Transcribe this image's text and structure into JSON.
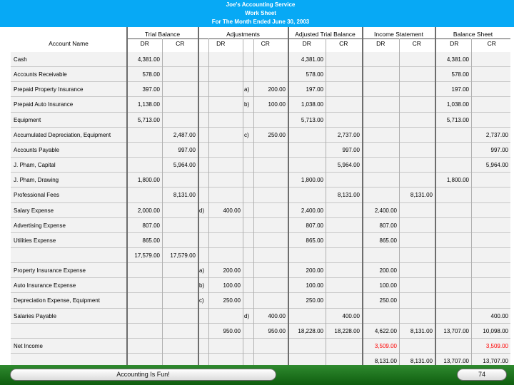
{
  "title": {
    "line1": "Joe's Accounting Service",
    "line2": "Work Sheet",
    "line3": "For The Month Ended June 30, 2003"
  },
  "columns": {
    "account_name": "Account Name",
    "groups": [
      "Trial Balance",
      "Adjustments",
      "Adjusted Trial Balance",
      "Income Statement",
      "Balance Sheet"
    ],
    "dr": "DR",
    "cr": "CR"
  },
  "rows": [
    {
      "name": "Cash",
      "tb_dr": "4,381.00",
      "tb_cr": "",
      "adj_dr_l": "",
      "adj_dr": "",
      "adj_cr_l": "",
      "adj_cr": "",
      "atb_dr": "4,381.00",
      "atb_cr": "",
      "is_dr": "",
      "is_cr": "",
      "bs_dr": "4,381.00",
      "bs_cr": ""
    },
    {
      "name": "Accounts Receivable",
      "tb_dr": "578.00",
      "tb_cr": "",
      "adj_dr_l": "",
      "adj_dr": "",
      "adj_cr_l": "",
      "adj_cr": "",
      "atb_dr": "578.00",
      "atb_cr": "",
      "is_dr": "",
      "is_cr": "",
      "bs_dr": "578.00",
      "bs_cr": ""
    },
    {
      "name": "Prepaid Property Insurance",
      "tb_dr": "397.00",
      "tb_cr": "",
      "adj_dr_l": "",
      "adj_dr": "",
      "adj_cr_l": "a)",
      "adj_cr": "200.00",
      "atb_dr": "197.00",
      "atb_cr": "",
      "is_dr": "",
      "is_cr": "",
      "bs_dr": "197.00",
      "bs_cr": ""
    },
    {
      "name": "Prepaid Auto Insurance",
      "tb_dr": "1,138.00",
      "tb_cr": "",
      "adj_dr_l": "",
      "adj_dr": "",
      "adj_cr_l": "b)",
      "adj_cr": "100.00",
      "atb_dr": "1,038.00",
      "atb_cr": "",
      "is_dr": "",
      "is_cr": "",
      "bs_dr": "1,038.00",
      "bs_cr": ""
    },
    {
      "name": "Equipment",
      "tb_dr": "5,713.00",
      "tb_cr": "",
      "adj_dr_l": "",
      "adj_dr": "",
      "adj_cr_l": "",
      "adj_cr": "",
      "atb_dr": "5,713.00",
      "atb_cr": "",
      "is_dr": "",
      "is_cr": "",
      "bs_dr": "5,713.00",
      "bs_cr": ""
    },
    {
      "name": "Accumulated Depreciation, Equipment",
      "tb_dr": "",
      "tb_cr": "2,487.00",
      "adj_dr_l": "",
      "adj_dr": "",
      "adj_cr_l": "c)",
      "adj_cr": "250.00",
      "atb_dr": "",
      "atb_cr": "2,737.00",
      "is_dr": "",
      "is_cr": "",
      "bs_dr": "",
      "bs_cr": "2,737.00"
    },
    {
      "name": "Accounts Payable",
      "tb_dr": "",
      "tb_cr": "997.00",
      "adj_dr_l": "",
      "adj_dr": "",
      "adj_cr_l": "",
      "adj_cr": "",
      "atb_dr": "",
      "atb_cr": "997.00",
      "is_dr": "",
      "is_cr": "",
      "bs_dr": "",
      "bs_cr": "997.00"
    },
    {
      "name": "J. Pham, Capital",
      "tb_dr": "",
      "tb_cr": "5,964.00",
      "adj_dr_l": "",
      "adj_dr": "",
      "adj_cr_l": "",
      "adj_cr": "",
      "atb_dr": "",
      "atb_cr": "5,964.00",
      "is_dr": "",
      "is_cr": "",
      "bs_dr": "",
      "bs_cr": "5,964.00"
    },
    {
      "name": "J. Pham, Drawing",
      "tb_dr": "1,800.00",
      "tb_cr": "",
      "adj_dr_l": "",
      "adj_dr": "",
      "adj_cr_l": "",
      "adj_cr": "",
      "atb_dr": "1,800.00",
      "atb_cr": "",
      "is_dr": "",
      "is_cr": "",
      "bs_dr": "1,800.00",
      "bs_cr": ""
    },
    {
      "name": "Professional Fees",
      "tb_dr": "",
      "tb_cr": "8,131.00",
      "adj_dr_l": "",
      "adj_dr": "",
      "adj_cr_l": "",
      "adj_cr": "",
      "atb_dr": "",
      "atb_cr": "8,131.00",
      "is_dr": "",
      "is_cr": "8,131.00",
      "bs_dr": "",
      "bs_cr": ""
    },
    {
      "name": "Salary Expense",
      "tb_dr": "2,000.00",
      "tb_cr": "",
      "adj_dr_l": "d)",
      "adj_dr": "400.00",
      "adj_cr_l": "",
      "adj_cr": "",
      "atb_dr": "2,400.00",
      "atb_cr": "",
      "is_dr": "2,400.00",
      "is_cr": "",
      "bs_dr": "",
      "bs_cr": ""
    },
    {
      "name": "Advertising Expense",
      "tb_dr": "807.00",
      "tb_cr": "",
      "adj_dr_l": "",
      "adj_dr": "",
      "adj_cr_l": "",
      "adj_cr": "",
      "atb_dr": "807.00",
      "atb_cr": "",
      "is_dr": "807.00",
      "is_cr": "",
      "bs_dr": "",
      "bs_cr": ""
    },
    {
      "name": "Utilities Expense",
      "tb_dr": "865.00",
      "tb_cr": "",
      "adj_dr_l": "",
      "adj_dr": "",
      "adj_cr_l": "",
      "adj_cr": "",
      "atb_dr": "865.00",
      "atb_cr": "",
      "is_dr": "865.00",
      "is_cr": "",
      "bs_dr": "",
      "bs_cr": ""
    },
    {
      "name": "",
      "tb_dr": "17,579.00",
      "tb_cr": "17,579.00",
      "adj_dr_l": "",
      "adj_dr": "",
      "adj_cr_l": "",
      "adj_cr": "",
      "atb_dr": "",
      "atb_cr": "",
      "is_dr": "",
      "is_cr": "",
      "bs_dr": "",
      "bs_cr": ""
    },
    {
      "name": "Property Insurance Expense",
      "tb_dr": "",
      "tb_cr": "",
      "adj_dr_l": "a)",
      "adj_dr": "200.00",
      "adj_cr_l": "",
      "adj_cr": "",
      "atb_dr": "200.00",
      "atb_cr": "",
      "is_dr": "200.00",
      "is_cr": "",
      "bs_dr": "",
      "bs_cr": ""
    },
    {
      "name": "Auto Insurance Expense",
      "tb_dr": "",
      "tb_cr": "",
      "adj_dr_l": "b)",
      "adj_dr": "100.00",
      "adj_cr_l": "",
      "adj_cr": "",
      "atb_dr": "100.00",
      "atb_cr": "",
      "is_dr": "100.00",
      "is_cr": "",
      "bs_dr": "",
      "bs_cr": ""
    },
    {
      "name": "Depreciation Expense, Equipment",
      "tb_dr": "",
      "tb_cr": "",
      "adj_dr_l": "c)",
      "adj_dr": "250.00",
      "adj_cr_l": "",
      "adj_cr": "",
      "atb_dr": "250.00",
      "atb_cr": "",
      "is_dr": "250.00",
      "is_cr": "",
      "bs_dr": "",
      "bs_cr": ""
    },
    {
      "name": "Salaries Payable",
      "tb_dr": "",
      "tb_cr": "",
      "adj_dr_l": "",
      "adj_dr": "",
      "adj_cr_l": "d)",
      "adj_cr": "400.00",
      "atb_dr": "",
      "atb_cr": "400.00",
      "is_dr": "",
      "is_cr": "",
      "bs_dr": "",
      "bs_cr": "400.00"
    },
    {
      "name": "",
      "tb_dr": "",
      "tb_cr": "",
      "adj_dr_l": "",
      "adj_dr": "950.00",
      "adj_cr_l": "",
      "adj_cr": "950.00",
      "atb_dr": "18,228.00",
      "atb_cr": "18,228.00",
      "is_dr": "4,622.00",
      "is_cr": "8,131.00",
      "bs_dr": "13,707.00",
      "bs_cr": "10,098.00"
    },
    {
      "name": "Net Income",
      "tb_dr": "",
      "tb_cr": "",
      "adj_dr_l": "",
      "adj_dr": "",
      "adj_cr_l": "",
      "adj_cr": "",
      "atb_dr": "",
      "atb_cr": "",
      "is_dr": "3,509.00",
      "is_cr": "",
      "bs_dr": "",
      "bs_cr": "3,509.00",
      "red": true
    },
    {
      "name": "",
      "tb_dr": "",
      "tb_cr": "",
      "adj_dr_l": "",
      "adj_dr": "",
      "adj_cr_l": "",
      "adj_cr": "",
      "atb_dr": "",
      "atb_cr": "",
      "is_dr": "8,131.00",
      "is_cr": "8,131.00",
      "bs_dr": "13,707.00",
      "bs_cr": "13,707.00"
    }
  ],
  "footer": {
    "caption": "Accounting Is Fun!",
    "page_number": "74"
  },
  "colors": {
    "header_bg": "#07a9f5",
    "footer_bg": "#1b6e1b",
    "net_income": "#ff0000"
  }
}
